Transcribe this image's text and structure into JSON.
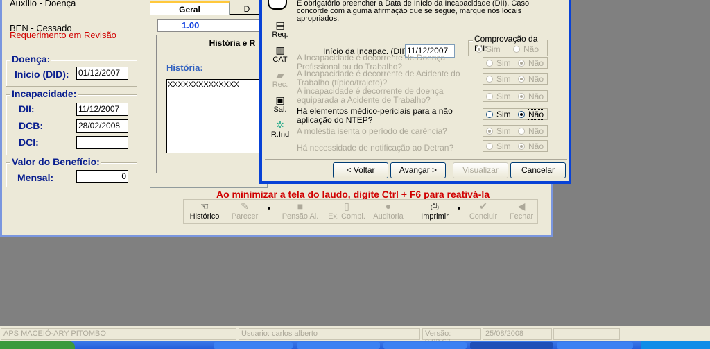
{
  "main": {
    "benefit_type": "Auxílio - Doença",
    "ben_status": "BEN - Cessado",
    "req_status": "Requerimento em Revisão",
    "doenca": {
      "title": "Doença:",
      "inicio_label": "Início (DID):",
      "inicio_value": "01/12/2007"
    },
    "incapacidade": {
      "title": "Incapacidade:",
      "dii_label": "DII:",
      "dii_value": "11/12/2007",
      "dcb_label": "DCB:",
      "dcb_value": "28/02/2008",
      "dci_label": "DCI:",
      "dci_value": ""
    },
    "valor": {
      "title": "Valor do Benefício:",
      "mensal_label": "Mensal:",
      "mensal_value": "0"
    },
    "tabs": [
      {
        "label": "Geral"
      },
      {
        "label": "D"
      }
    ],
    "version_field": "1.00",
    "subtab": "História e R",
    "historia_label": "História:",
    "historia_value": "XXXXXXXXXXXXXX",
    "warning": "Ao minimizar a tela do laudo, digite Ctrl + F6 para reativá-la",
    "toolbar": [
      {
        "label": "Histórico",
        "icon": "history-icon",
        "enabled": true
      },
      {
        "label": "Parecer",
        "icon": "opinion-icon",
        "enabled": false
      },
      {
        "label": "Pensão Al.",
        "icon": "pension-icon",
        "enabled": false
      },
      {
        "label": "Ex. Compl.",
        "icon": "exam-icon",
        "enabled": false
      },
      {
        "label": "Auditoria",
        "icon": "audit-icon",
        "enabled": false
      },
      {
        "label": "Imprimir",
        "icon": "printer-icon",
        "enabled": true
      },
      {
        "label": "Concluir",
        "icon": "check-icon",
        "enabled": false
      },
      {
        "label": "Fechar",
        "icon": "exit-icon",
        "enabled": false
      }
    ]
  },
  "dialog": {
    "message": [
      "É obrigatório preencher a Data de Início da Incapacidade (DII). Caso",
      "concorde com alguma afirmação que se segue, marque nos locais",
      "apropriados."
    ],
    "side": [
      {
        "label": "Req.",
        "icon": "document-icon"
      },
      {
        "label": "CAT",
        "icon": "cat-icon"
      },
      {
        "label": "Rec.",
        "icon": "folder-icon"
      },
      {
        "label": "Sal.",
        "icon": "clipboard-icon"
      },
      {
        "label": "R.Ind",
        "icon": "search-report-icon"
      }
    ],
    "dii_label": "Início da Incapac. (DII):",
    "dii_value": "11/12/2007",
    "comprovacao": {
      "title": "Comprovação da DII:",
      "sim": "Sim",
      "nao": "Não",
      "selected": "Sim"
    },
    "questions": [
      {
        "text": "A Incapacidade é decorrente de Doença Profissional ou do Trabalho?",
        "selected": "Não",
        "enabled": false
      },
      {
        "text": "A Incapacidade é decorrente de Acidente do Trabalho (típico/trajeto)?",
        "selected": "Não",
        "enabled": false
      },
      {
        "text": "A incapacidade é decorrente de doença equiparada a Acidente de Trabalho?",
        "selected": "Não",
        "enabled": false
      },
      {
        "text": "Há elementos médico-periciais para a não aplicação do NTEP?",
        "selected": "Não",
        "enabled": true
      },
      {
        "text": "A moléstia isenta o período de carência?",
        "selected": "Sim",
        "enabled": false
      },
      {
        "text": "Há necessidade de notificação ao Detran?",
        "selected": "Não",
        "enabled": false
      }
    ],
    "sim": "Sim",
    "nao": "Não",
    "buttons": {
      "back": "< Voltar",
      "next": "Avançar >",
      "view": "Visualizar",
      "cancel": "Cancelar"
    }
  },
  "status": {
    "agency": "APS MACEIÓ-ARY PITOMBO",
    "user": "Usuario: carlos alberto",
    "version": "Versão: 9.02.67",
    "date": "25/08/2008"
  }
}
